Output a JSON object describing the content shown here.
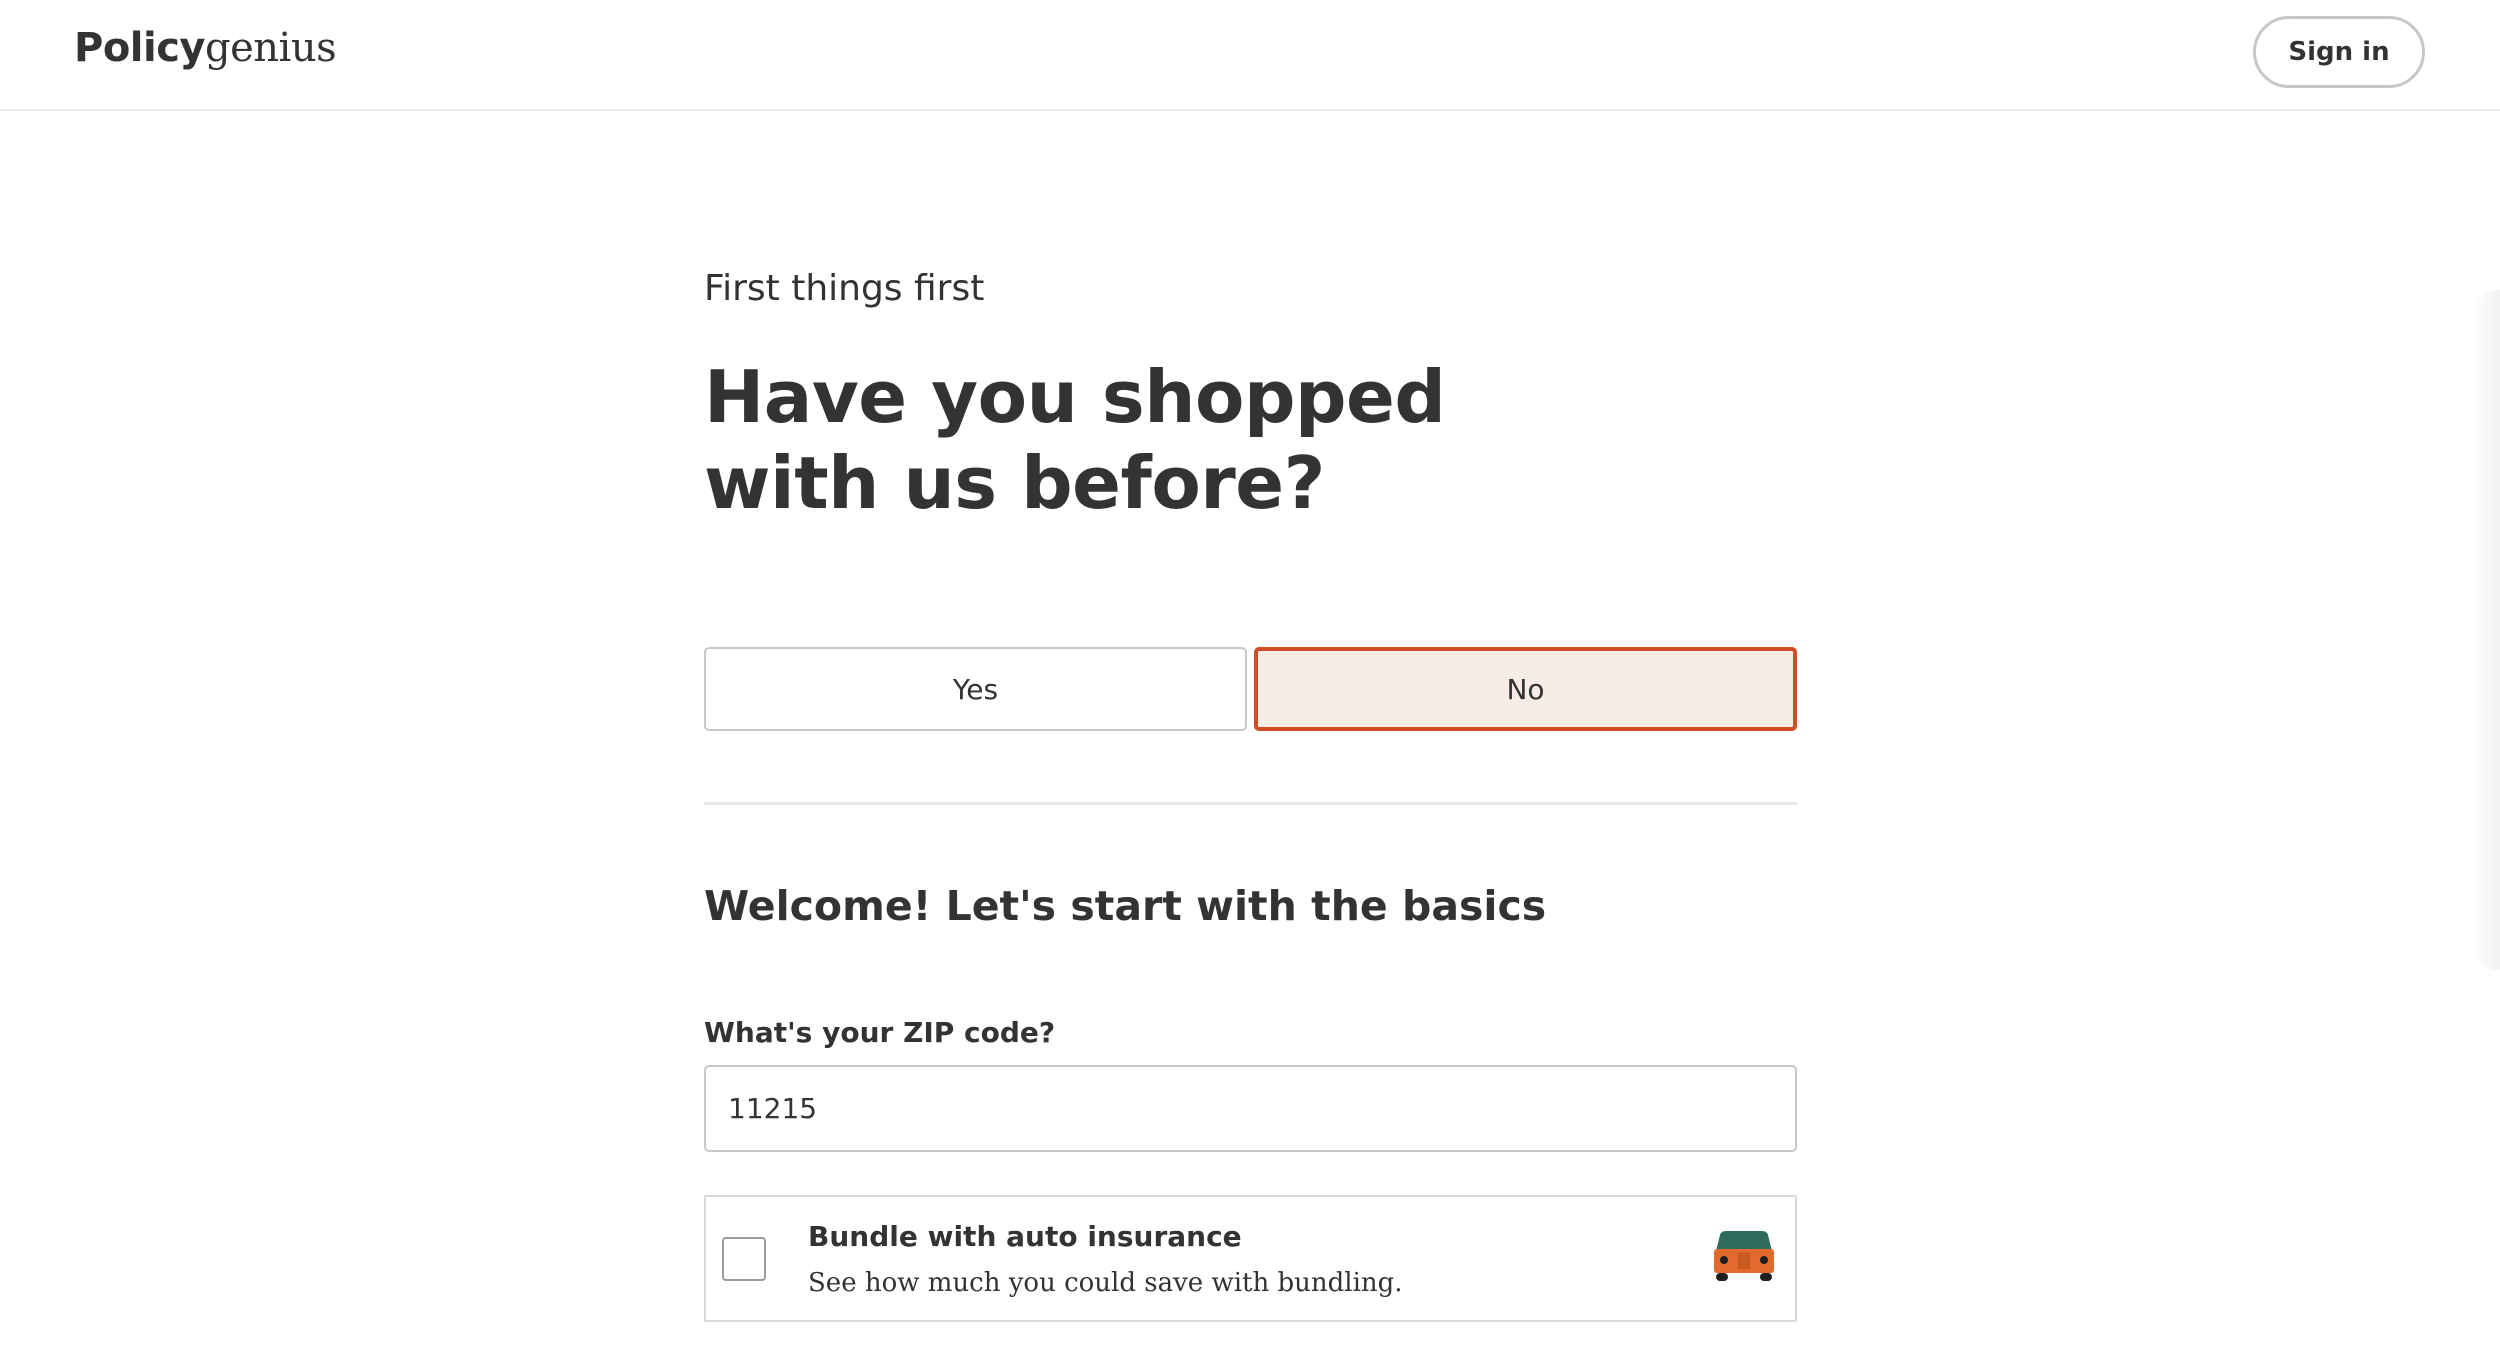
{
  "header": {
    "logo_bold": "Policy",
    "logo_serif": "genius",
    "signin_label": "Sign in"
  },
  "main": {
    "eyebrow": "First things first",
    "question": "Have you shopped with us before?",
    "choices": {
      "yes_label": "Yes",
      "no_label": "No",
      "selected": "No"
    },
    "section_title": "Welcome! Let's start with the basics",
    "zip": {
      "label": "What's your ZIP code?",
      "value": "11215"
    },
    "bundle": {
      "title": "Bundle with auto insurance",
      "description": "See how much you could save with bundling.",
      "checked": false,
      "icon": "car-icon"
    }
  },
  "colors": {
    "accent": "#d14d26",
    "selected_bg": "#f8ece7",
    "text": "#333333",
    "car_body": "#e26a2c",
    "car_roof": "#2f6b5a"
  }
}
